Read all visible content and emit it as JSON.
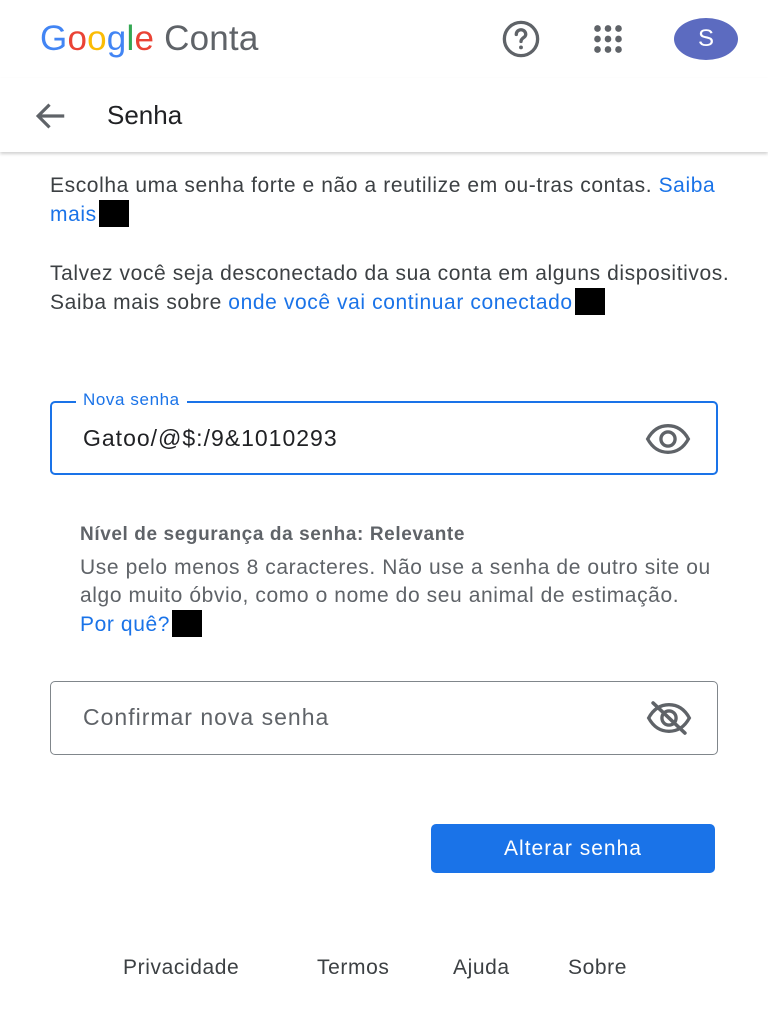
{
  "header": {
    "logo_letters": [
      "G",
      "o",
      "o",
      "g",
      "l",
      "e"
    ],
    "product": "Conta",
    "help_icon": "help-circle-icon",
    "apps_icon": "apps-grid-icon",
    "avatar_initial": "S",
    "avatar_color": "#5c6bc0"
  },
  "subheader": {
    "back_icon": "arrow-back-icon",
    "title": "Senha"
  },
  "intro": {
    "text1": "Escolha uma senha forte e não a reutilize em ou-tras contas. ",
    "link1": "Saiba mais",
    "text2": "Talvez você seja desconectado da sua conta em alguns dispositivos. Saiba mais sobre ",
    "link2": "onde você vai continuar conectado"
  },
  "new_password": {
    "label": "Nova senha",
    "value": "Gatoo/@$:/9&1010293",
    "toggle_icon": "eye-icon"
  },
  "strength": {
    "title": "Nível de segurança da senha: Relevante",
    "text": "Use pelo menos 8 caracteres. Não use a senha de outro site ou algo muito óbvio, como o nome do seu animal de estimação. ",
    "link": "Por quê?"
  },
  "confirm_password": {
    "placeholder": "Confirmar nova senha",
    "toggle_icon": "eye-off-icon"
  },
  "submit": {
    "label": "Alterar senha"
  },
  "footer": {
    "links": [
      "Privacidade",
      "Termos",
      "Ajuda",
      "Sobre"
    ]
  },
  "colors": {
    "accent": "#1a73e8",
    "text": "#202124",
    "muted": "#5f6368"
  }
}
